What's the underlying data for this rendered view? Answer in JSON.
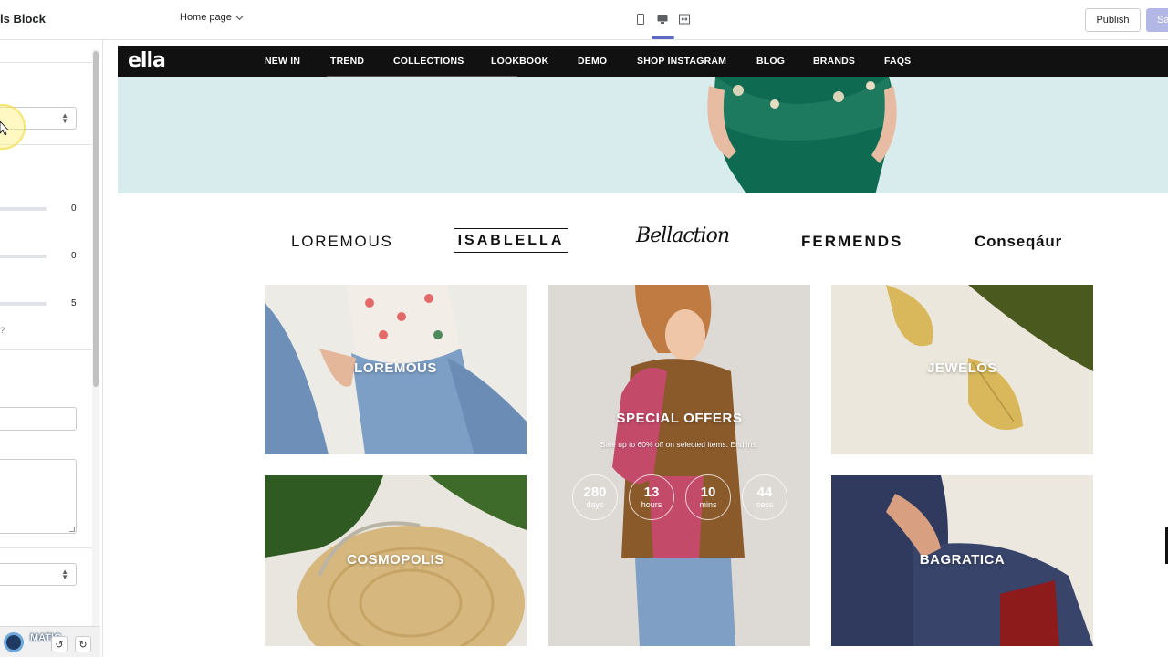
{
  "editor": {
    "panel_title": "ls Block",
    "page_select": "Home page",
    "devices": [
      "mobile-icon",
      "desktop-icon",
      "full-width-icon"
    ],
    "publish_label": "Publish",
    "save_label": "Sa",
    "accent_color": "#5c6ac4"
  },
  "sidebar": {
    "slider_values": [
      "0",
      "0",
      "5"
    ],
    "question_mark": "?",
    "recorder_label": "MATIC"
  },
  "store": {
    "logo": "ella",
    "nav": [
      "NEW IN",
      "TREND",
      "COLLECTIONS",
      "LOOKBOOK",
      "DEMO",
      "SHOP INSTAGRAM",
      "BLOG",
      "BRANDS",
      "FAQS"
    ],
    "brands": [
      "LOREMOUS",
      "ISABLELLA",
      "Bellaction",
      "FERMENDS",
      "Conseqáur"
    ],
    "tiles": {
      "t1": "LOREMOUS",
      "t3": "JEWELOS",
      "t4": "COSMOPOLIS",
      "t5": "BAGRATICA"
    },
    "offer": {
      "title": "SPECIAL OFFERS",
      "subtitle": "Sale up to 60% off on selected items. End ins:",
      "countdown": [
        {
          "num": "280",
          "unit": "days"
        },
        {
          "num": "13",
          "unit": "hours"
        },
        {
          "num": "10",
          "unit": "mins"
        },
        {
          "num": "44",
          "unit": "secs"
        }
      ]
    }
  }
}
